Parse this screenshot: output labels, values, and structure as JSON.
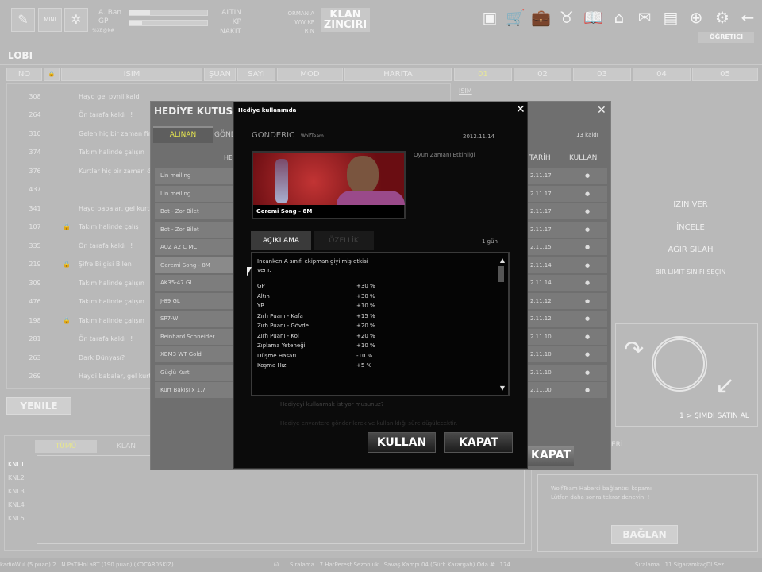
{
  "topbar": {
    "level_label": "A. Ban",
    "gp_label": "GP",
    "sub_label": "%XE@k#",
    "level_progress": 0.27,
    "gp_progress": 0.16,
    "currency_labels": [
      "ALTIN",
      "KP",
      "NAKIT"
    ],
    "mini_labels": [
      [
        "ORMAN",
        "A"
      ],
      [
        "WW",
        "KP"
      ],
      [
        "R",
        "N"
      ]
    ],
    "klan": [
      "KLAN",
      "ZINCIRI"
    ],
    "tutorial": "ÖĞRETICI",
    "icons": [
      "edit-icon",
      "mini-icon",
      "settings-snowflake-icon",
      "gallery-icon",
      "cart-icon",
      "inventory-icon",
      "wolf-icon",
      "book-icon",
      "clan-icon",
      "mail-icon",
      "profile-folder-icon",
      "globe-search-icon",
      "gear-icon",
      "back-arrow-icon"
    ]
  },
  "lobby": {
    "title": "LOBI",
    "headers": [
      "NO",
      "🔒",
      "ISIM",
      "ŞUAN",
      "SAYI",
      "MOD",
      "HARITA"
    ],
    "channel_tabs": [
      "01",
      "02",
      "03",
      "04",
      "05"
    ],
    "right_label": "ISIM",
    "rows": [
      {
        "no": "308",
        "lock": "",
        "name": "Hayd gel pvnil kald"
      },
      {
        "no": "264",
        "lock": "",
        "name": "Ön tarafa kaldı !!"
      },
      {
        "no": "310",
        "lock": "",
        "name": "Gelen hiç bir zaman firmaz"
      },
      {
        "no": "374",
        "lock": "",
        "name": "Takım halinde çalışın"
      },
      {
        "no": "376",
        "lock": "",
        "name": "Kurtlar hiç bir zaman ölmez"
      },
      {
        "no": "437",
        "lock": "",
        "name": ""
      },
      {
        "no": "341",
        "lock": "",
        "name": "Hayd babalar, gel kurt"
      },
      {
        "no": "107",
        "lock": "🔒",
        "name": "Takım halinde çalış"
      },
      {
        "no": "335",
        "lock": "",
        "name": "Ön tarafa kaldı !!"
      },
      {
        "no": "219",
        "lock": "🔒",
        "name": "Şifre Bilgisi Bilen"
      },
      {
        "no": "309",
        "lock": "",
        "name": "Takım halinde çalışın"
      },
      {
        "no": "476",
        "lock": "",
        "name": "Takım halinde çalışın"
      },
      {
        "no": "198",
        "lock": "🔒",
        "name": "Takım halinde çalışın"
      },
      {
        "no": "281",
        "lock": "",
        "name": "Ön tarafa kaldı !!"
      },
      {
        "no": "263",
        "lock": "",
        "name": "Dark Dünyası?"
      },
      {
        "no": "269",
        "lock": "",
        "name": "Haydi babalar, gel kurt"
      }
    ],
    "refresh": "YENILE"
  },
  "right_menu": {
    "items": [
      "IZIN VER",
      "İNCELE",
      "AĞIR SILAH",
      "BIR LIMIT SINIFI SEÇIN"
    ],
    "buy_now": "1 > ŞIMDI SATIN AL"
  },
  "chat": {
    "tabs": [
      "TÜMÜ",
      "KLAN"
    ],
    "channels": [
      "KNL1",
      "KNL2",
      "KNL3",
      "KNL4",
      "KNL5"
    ]
  },
  "connect": {
    "title": "ERİ",
    "message": [
      "WolfTeam Haberci bağlantısı kopamı",
      "Lütfen daha sonra tekrar deneyin. !"
    ],
    "button": "BAĞLAN"
  },
  "status_bar": {
    "left": "kadioWul (5 puan) 2 . N PaTlHoLaRT (190 puan) (KOCAR05KIZ)",
    "middle": "Sıralama . 7 HatPerest Sezonluk . Savaş Kampı 04 (Gürk Karargah) Oda # . 174",
    "right": "Sıralama . 11 SigaramkaçDl Sez"
  },
  "gift_box": {
    "title": "HEDİYE KUTUSU",
    "tabs": [
      "ALINAN",
      "GÖNDERİLEN"
    ],
    "count": "13 kaldı",
    "headers": [
      "HEDİYE",
      "TARİH",
      "KULLAN"
    ],
    "items": [
      {
        "name": "Lin meiling",
        "date": "2.11.17"
      },
      {
        "name": "Lin meiling",
        "date": "2.11.17"
      },
      {
        "name": "Bot - Zor Bilet",
        "date": "2.11.17"
      },
      {
        "name": "Bot - Zor Bilet",
        "date": "2.11.17"
      },
      {
        "name": "AUZ A2 C MC",
        "date": "2.11.15"
      },
      {
        "name": "Geremi Song - 8M",
        "date": "2.11.14"
      },
      {
        "name": "AK35-47 GL",
        "date": "2.11.14"
      },
      {
        "name": "J-89 GL",
        "date": "2.11.12"
      },
      {
        "name": "SP7-W",
        "date": "2.11.12"
      },
      {
        "name": "Reinhard Schneider",
        "date": "2.11.10"
      },
      {
        "name": "XBM3 WT Gold",
        "date": "2.11.10"
      },
      {
        "name": "Güçlü Kurt",
        "date": "2.11.10"
      },
      {
        "name": "Kurt Bakışı x 1.7",
        "date": "2.11.00"
      }
    ],
    "use_mark": "●",
    "close_label": "KAPAT"
  },
  "dialog": {
    "title": "Hediye kullanımda",
    "sender_label": "GONDERIC",
    "sender": "WolfTeam",
    "date": "2012.11.14",
    "event": "Oyun Zamanı Etkinliği",
    "item_name": "Geremi Song - 8M",
    "tabs": [
      "AÇIKLAMA",
      "ÖZELLİK"
    ],
    "duration": "1 gün",
    "description": [
      "Incanken A sınıfı ekipman giyilmiş etkisi",
      "verir."
    ],
    "stats": [
      {
        "name": "GP",
        "value": "+30 %"
      },
      {
        "name": "Altın",
        "value": "+30 %"
      },
      {
        "name": "YP",
        "value": "+10 %"
      },
      {
        "name": "Zırh Puanı - Kafa",
        "value": "+15 %"
      },
      {
        "name": "Zırh Puanı - Gövde",
        "value": "+20 %"
      },
      {
        "name": "Zırh Puanı - Kol",
        "value": "+20 %"
      },
      {
        "name": "Zıplama Yeteneği",
        "value": "+10 %"
      },
      {
        "name": "Düşme Hasarı",
        "value": "-10 %"
      },
      {
        "name": "Koşma Hızı",
        "value": "+5 %"
      }
    ],
    "question": "Hediyeyi kullanmak istiyor musunuz?",
    "note": "Hediye envantere gönderilerek ve kullanıldığı süre düşülecektir.",
    "use_button": "KULLAN",
    "close_button": "KAPAT"
  }
}
